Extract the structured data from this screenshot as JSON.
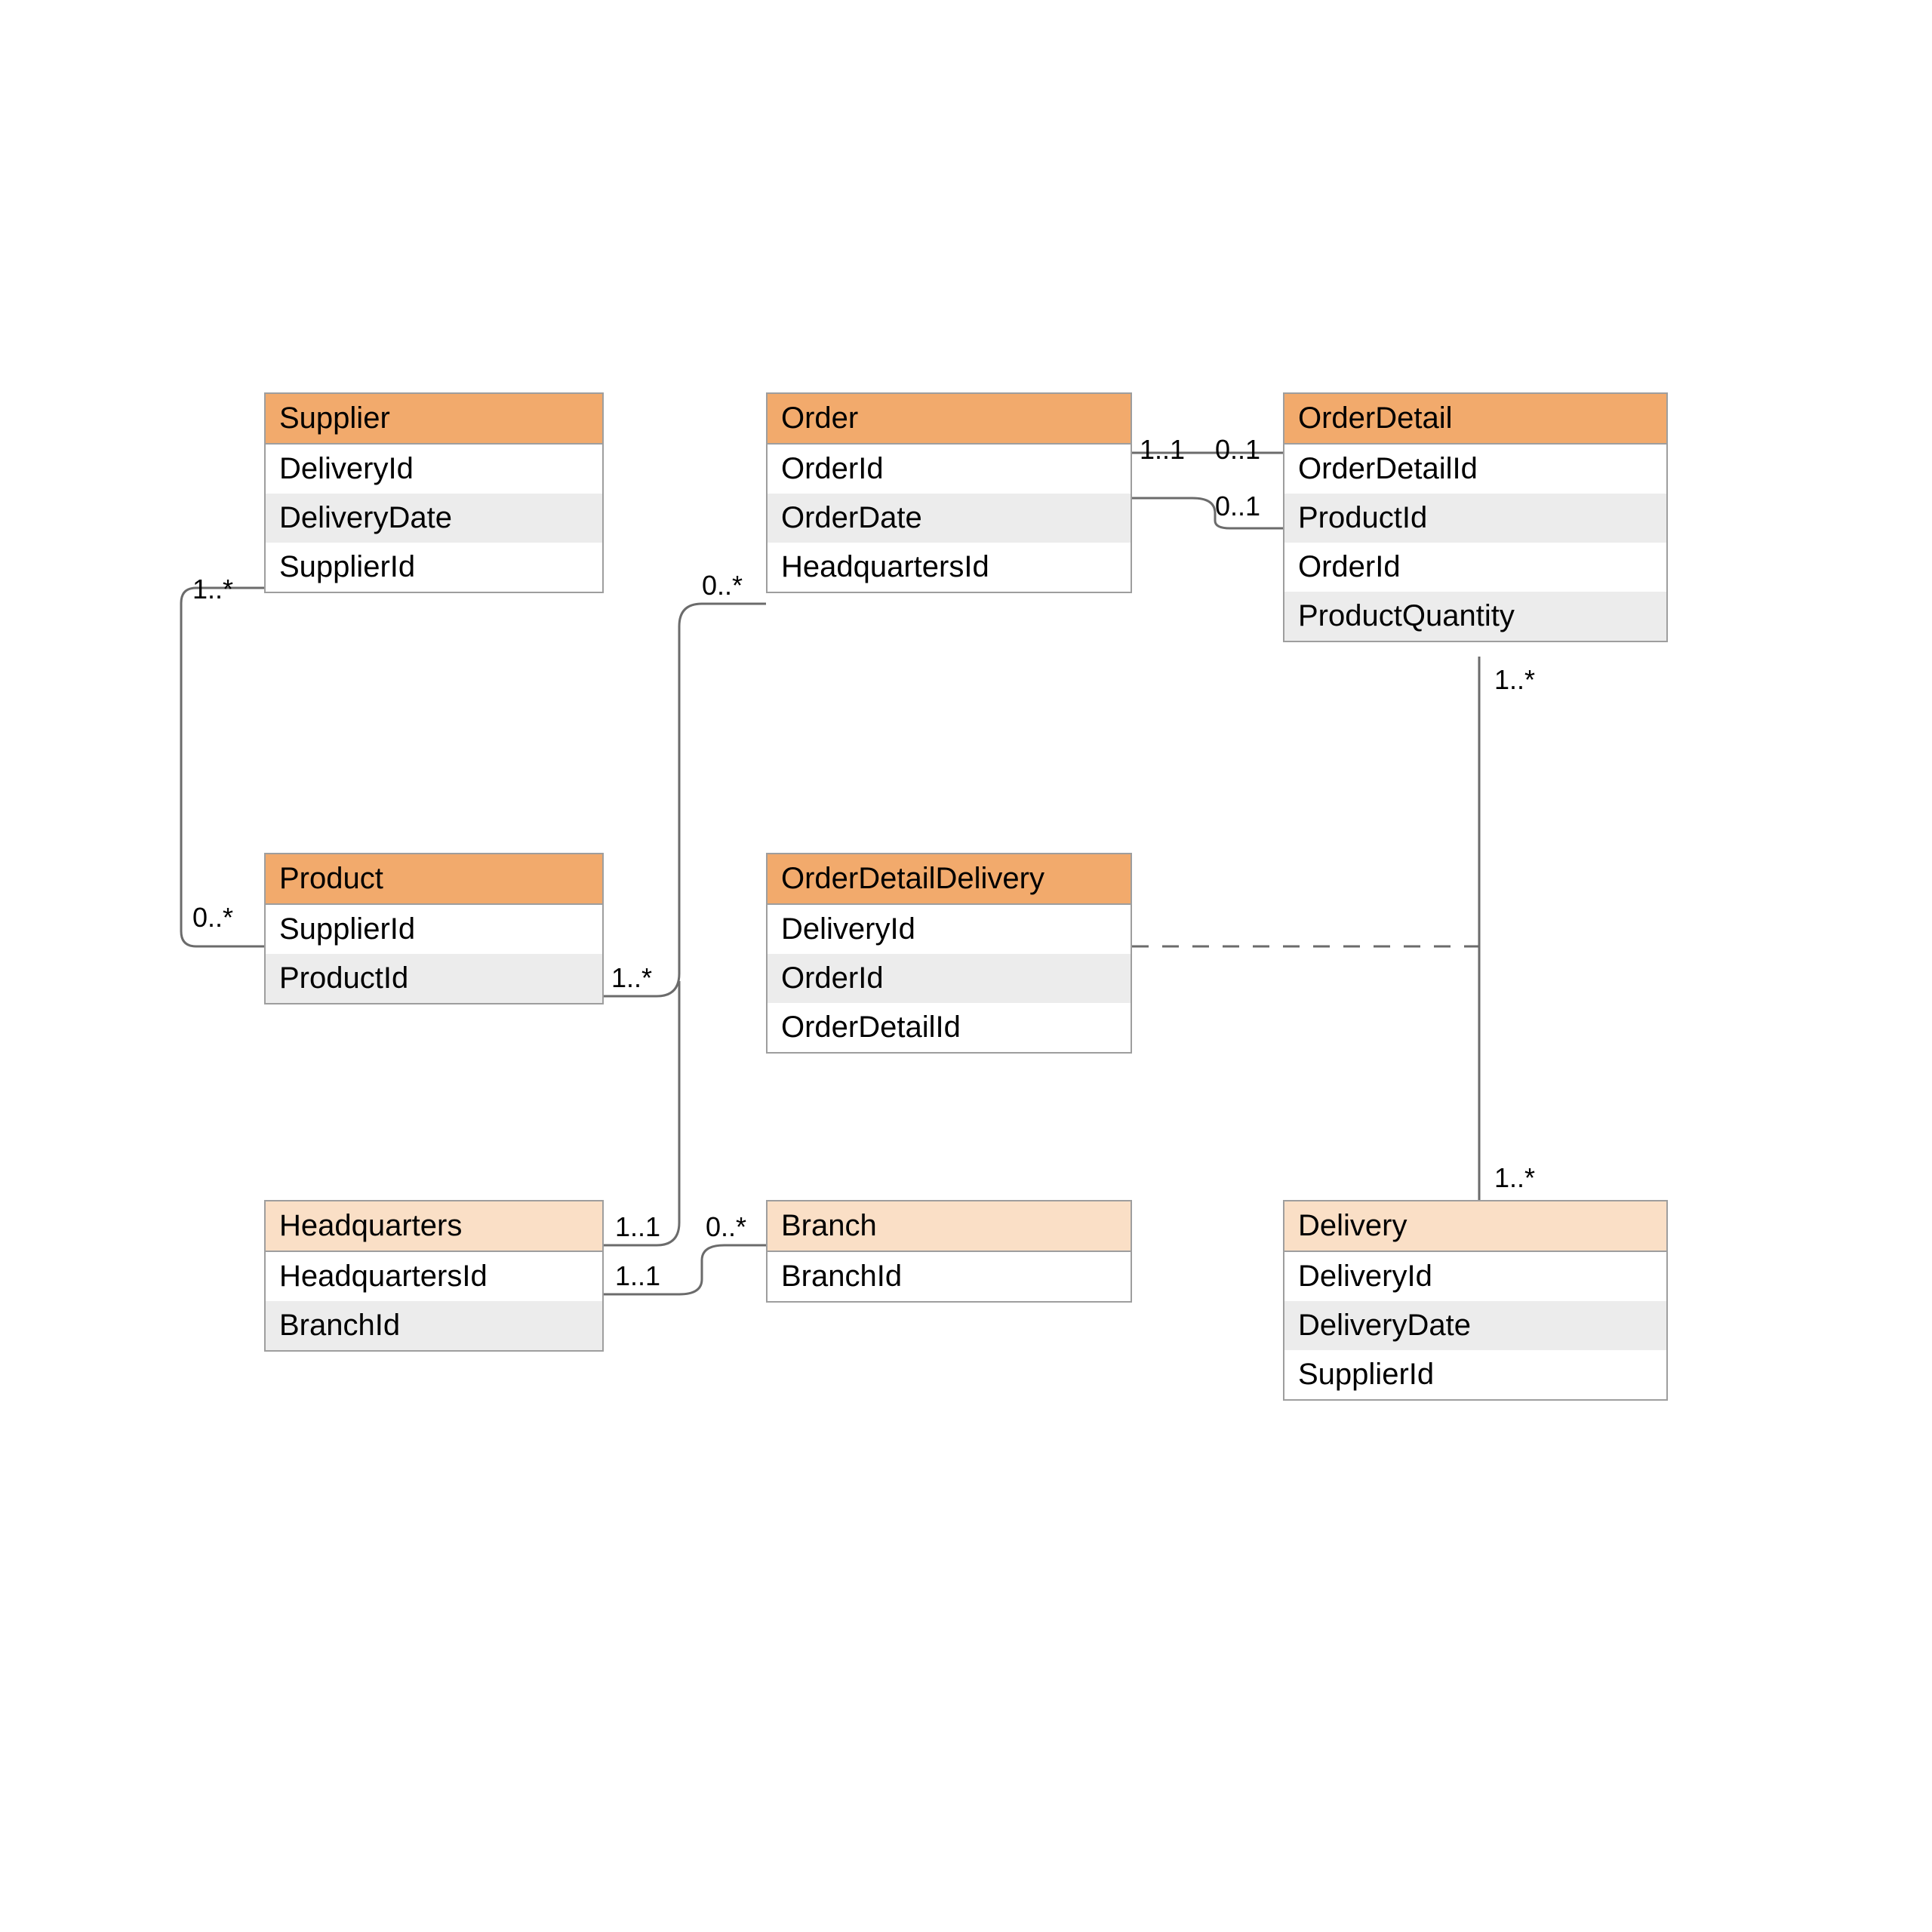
{
  "entities": {
    "supplier": {
      "title": "Supplier",
      "attrs": [
        "DeliveryId",
        "DeliveryDate",
        "SupplierId"
      ]
    },
    "order": {
      "title": "Order",
      "attrs": [
        "OrderId",
        "OrderDate",
        "HeadquartersId"
      ]
    },
    "orderDetail": {
      "title": "OrderDetail",
      "attrs": [
        "OrderDetailId",
        "ProductId",
        "OrderId",
        "ProductQuantity"
      ]
    },
    "product": {
      "title": "Product",
      "attrs": [
        "SupplierId",
        "ProductId"
      ]
    },
    "orderDetailDelivery": {
      "title": "OrderDetailDelivery",
      "attrs": [
        "DeliveryId",
        "OrderId",
        "OrderDetailId"
      ]
    },
    "headquarters": {
      "title": "Headquarters",
      "attrs": [
        "HeadquartersId",
        "BranchId"
      ]
    },
    "branch": {
      "title": "Branch",
      "attrs": [
        "BranchId"
      ]
    },
    "delivery": {
      "title": "Delivery",
      "attrs": [
        "DeliveryId",
        "DeliveryDate",
        "SupplierId"
      ]
    }
  },
  "multiplicities": {
    "supplier_product_top": "1..*",
    "supplier_product_bottom": "0..*",
    "order_left": "0..*",
    "order_right": "1..1",
    "orderDetail_top1": "0..1",
    "orderDetail_top2": "0..1",
    "orderDetail_bottom": "1..*",
    "product_right": "1..*",
    "hq_top": "1..1",
    "hq_bottom": "1..1",
    "branch_left": "0..*",
    "delivery_top": "1..*"
  }
}
